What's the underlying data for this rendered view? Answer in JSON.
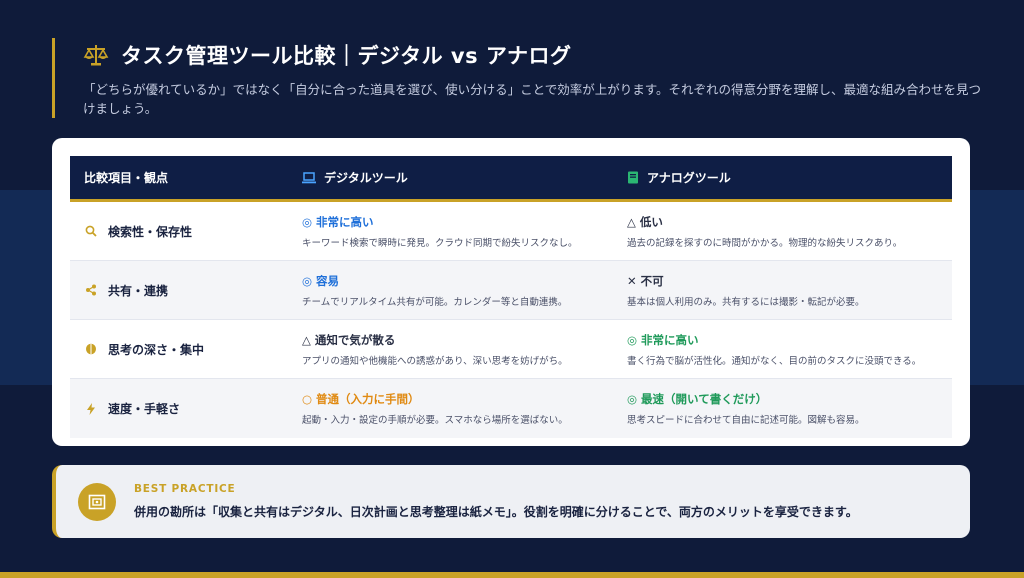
{
  "header": {
    "title": "タスク管理ツール比較｜デジタル vs アナログ",
    "subtitle": "「どちらが優れているか」ではなく「自分に合った道具を選び、使い分ける」ことで効率が上がります。それぞれの得意分野を理解し、最適な組み合わせを見つけましょう。",
    "icon": "scale-icon"
  },
  "table": {
    "headers": {
      "criteria": "比較項目・観点",
      "digital": "デジタルツール",
      "analog": "アナログツール",
      "digital_icon": "laptop-icon",
      "analog_icon": "notebook-icon"
    },
    "rows": [
      {
        "criteria": "検索性・保存性",
        "icon": "search-icon",
        "digital_head": "◎ 非常に高い",
        "digital_desc": "キーワード検索で瞬時に発見。クラウド同期で紛失リスクなし。",
        "analog_head": "△ 低い",
        "analog_desc": "過去の記録を探すのに時間がかかる。物理的な紛失リスクあり。"
      },
      {
        "criteria": "共有・連携",
        "icon": "share-icon",
        "digital_head": "◎ 容易",
        "digital_desc": "チームでリアルタイム共有が可能。カレンダー等と自動連携。",
        "analog_head": "✕ 不可",
        "analog_desc": "基本は個人利用のみ。共有するには撮影・転記が必要。"
      },
      {
        "criteria": "思考の深さ・集中",
        "icon": "brain-icon",
        "digital_head": "△ 通知で気が散る",
        "digital_desc": "アプリの通知や他機能への誘惑があり、深い思考を妨げがち。",
        "analog_head": "◎ 非常に高い",
        "analog_desc": "書く行為で脳が活性化。通知がなく、目の前のタスクに没頭できる。"
      },
      {
        "criteria": "速度・手軽さ",
        "icon": "lightning-icon",
        "digital_head": "○ 普通（入力に手間）",
        "digital_desc": "起動・入力・設定の手順が必要。スマホなら場所を選ばない。",
        "analog_head": "◎ 最速（開いて書くだけ）",
        "analog_desc": "思考スピードに合わせて自由に記述可能。図解も容易。"
      }
    ]
  },
  "practice": {
    "label": "BEST PRACTICE",
    "text": "併用の勘所は「収集と共有はデジタル、日次計画と思考整理は紙メモ」。役割を明確に分けることで、両方のメリットを享受できます。",
    "icon": "frame-icon"
  },
  "colors": {
    "accent": "#c9a227",
    "navy": "#0f1e45",
    "good_blue": "#1e6fd9",
    "good_green": "#1f9a5a",
    "neutral_orange": "#e08a12"
  }
}
